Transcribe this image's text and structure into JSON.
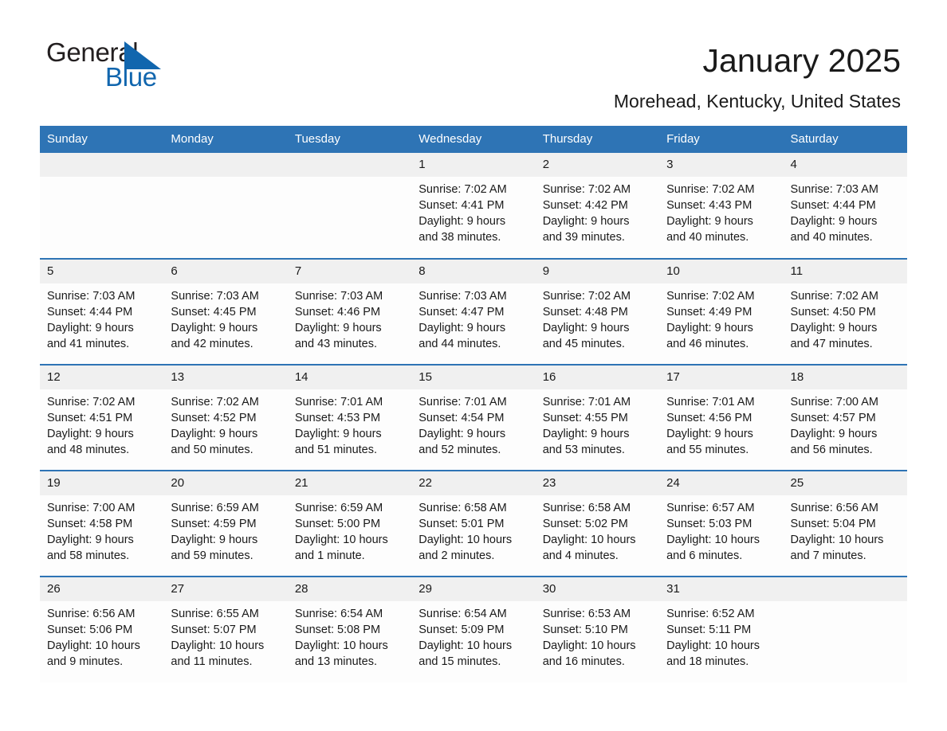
{
  "brand": {
    "word_one": "General",
    "word_two": "Blue",
    "triangle_color": "#1166ae",
    "accent_color": "#2e74b5"
  },
  "header": {
    "month_title": "January 2025",
    "location": "Morehead, Kentucky, United States"
  },
  "calendar": {
    "weekday_headers": [
      "Sunday",
      "Monday",
      "Tuesday",
      "Wednesday",
      "Thursday",
      "Friday",
      "Saturday"
    ],
    "weeks": [
      [
        {
          "day": "",
          "empty": true
        },
        {
          "day": "",
          "empty": true
        },
        {
          "day": "",
          "empty": true
        },
        {
          "day": "1",
          "sunrise": "Sunrise: 7:02 AM",
          "sunset": "Sunset: 4:41 PM",
          "daylight": "Daylight: 9 hours and 38 minutes."
        },
        {
          "day": "2",
          "sunrise": "Sunrise: 7:02 AM",
          "sunset": "Sunset: 4:42 PM",
          "daylight": "Daylight: 9 hours and 39 minutes."
        },
        {
          "day": "3",
          "sunrise": "Sunrise: 7:02 AM",
          "sunset": "Sunset: 4:43 PM",
          "daylight": "Daylight: 9 hours and 40 minutes."
        },
        {
          "day": "4",
          "sunrise": "Sunrise: 7:03 AM",
          "sunset": "Sunset: 4:44 PM",
          "daylight": "Daylight: 9 hours and 40 minutes."
        }
      ],
      [
        {
          "day": "5",
          "sunrise": "Sunrise: 7:03 AM",
          "sunset": "Sunset: 4:44 PM",
          "daylight": "Daylight: 9 hours and 41 minutes."
        },
        {
          "day": "6",
          "sunrise": "Sunrise: 7:03 AM",
          "sunset": "Sunset: 4:45 PM",
          "daylight": "Daylight: 9 hours and 42 minutes."
        },
        {
          "day": "7",
          "sunrise": "Sunrise: 7:03 AM",
          "sunset": "Sunset: 4:46 PM",
          "daylight": "Daylight: 9 hours and 43 minutes."
        },
        {
          "day": "8",
          "sunrise": "Sunrise: 7:03 AM",
          "sunset": "Sunset: 4:47 PM",
          "daylight": "Daylight: 9 hours and 44 minutes."
        },
        {
          "day": "9",
          "sunrise": "Sunrise: 7:02 AM",
          "sunset": "Sunset: 4:48 PM",
          "daylight": "Daylight: 9 hours and 45 minutes."
        },
        {
          "day": "10",
          "sunrise": "Sunrise: 7:02 AM",
          "sunset": "Sunset: 4:49 PM",
          "daylight": "Daylight: 9 hours and 46 minutes."
        },
        {
          "day": "11",
          "sunrise": "Sunrise: 7:02 AM",
          "sunset": "Sunset: 4:50 PM",
          "daylight": "Daylight: 9 hours and 47 minutes."
        }
      ],
      [
        {
          "day": "12",
          "sunrise": "Sunrise: 7:02 AM",
          "sunset": "Sunset: 4:51 PM",
          "daylight": "Daylight: 9 hours and 48 minutes."
        },
        {
          "day": "13",
          "sunrise": "Sunrise: 7:02 AM",
          "sunset": "Sunset: 4:52 PM",
          "daylight": "Daylight: 9 hours and 50 minutes."
        },
        {
          "day": "14",
          "sunrise": "Sunrise: 7:01 AM",
          "sunset": "Sunset: 4:53 PM",
          "daylight": "Daylight: 9 hours and 51 minutes."
        },
        {
          "day": "15",
          "sunrise": "Sunrise: 7:01 AM",
          "sunset": "Sunset: 4:54 PM",
          "daylight": "Daylight: 9 hours and 52 minutes."
        },
        {
          "day": "16",
          "sunrise": "Sunrise: 7:01 AM",
          "sunset": "Sunset: 4:55 PM",
          "daylight": "Daylight: 9 hours and 53 minutes."
        },
        {
          "day": "17",
          "sunrise": "Sunrise: 7:01 AM",
          "sunset": "Sunset: 4:56 PM",
          "daylight": "Daylight: 9 hours and 55 minutes."
        },
        {
          "day": "18",
          "sunrise": "Sunrise: 7:00 AM",
          "sunset": "Sunset: 4:57 PM",
          "daylight": "Daylight: 9 hours and 56 minutes."
        }
      ],
      [
        {
          "day": "19",
          "sunrise": "Sunrise: 7:00 AM",
          "sunset": "Sunset: 4:58 PM",
          "daylight": "Daylight: 9 hours and 58 minutes."
        },
        {
          "day": "20",
          "sunrise": "Sunrise: 6:59 AM",
          "sunset": "Sunset: 4:59 PM",
          "daylight": "Daylight: 9 hours and 59 minutes."
        },
        {
          "day": "21",
          "sunrise": "Sunrise: 6:59 AM",
          "sunset": "Sunset: 5:00 PM",
          "daylight": "Daylight: 10 hours and 1 minute."
        },
        {
          "day": "22",
          "sunrise": "Sunrise: 6:58 AM",
          "sunset": "Sunset: 5:01 PM",
          "daylight": "Daylight: 10 hours and 2 minutes."
        },
        {
          "day": "23",
          "sunrise": "Sunrise: 6:58 AM",
          "sunset": "Sunset: 5:02 PM",
          "daylight": "Daylight: 10 hours and 4 minutes."
        },
        {
          "day": "24",
          "sunrise": "Sunrise: 6:57 AM",
          "sunset": "Sunset: 5:03 PM",
          "daylight": "Daylight: 10 hours and 6 minutes."
        },
        {
          "day": "25",
          "sunrise": "Sunrise: 6:56 AM",
          "sunset": "Sunset: 5:04 PM",
          "daylight": "Daylight: 10 hours and 7 minutes."
        }
      ],
      [
        {
          "day": "26",
          "sunrise": "Sunrise: 6:56 AM",
          "sunset": "Sunset: 5:06 PM",
          "daylight": "Daylight: 10 hours and 9 minutes."
        },
        {
          "day": "27",
          "sunrise": "Sunrise: 6:55 AM",
          "sunset": "Sunset: 5:07 PM",
          "daylight": "Daylight: 10 hours and 11 minutes."
        },
        {
          "day": "28",
          "sunrise": "Sunrise: 6:54 AM",
          "sunset": "Sunset: 5:08 PM",
          "daylight": "Daylight: 10 hours and 13 minutes."
        },
        {
          "day": "29",
          "sunrise": "Sunrise: 6:54 AM",
          "sunset": "Sunset: 5:09 PM",
          "daylight": "Daylight: 10 hours and 15 minutes."
        },
        {
          "day": "30",
          "sunrise": "Sunrise: 6:53 AM",
          "sunset": "Sunset: 5:10 PM",
          "daylight": "Daylight: 10 hours and 16 minutes."
        },
        {
          "day": "31",
          "sunrise": "Sunrise: 6:52 AM",
          "sunset": "Sunset: 5:11 PM",
          "daylight": "Daylight: 10 hours and 18 minutes."
        },
        {
          "day": "",
          "empty": true
        }
      ]
    ]
  }
}
